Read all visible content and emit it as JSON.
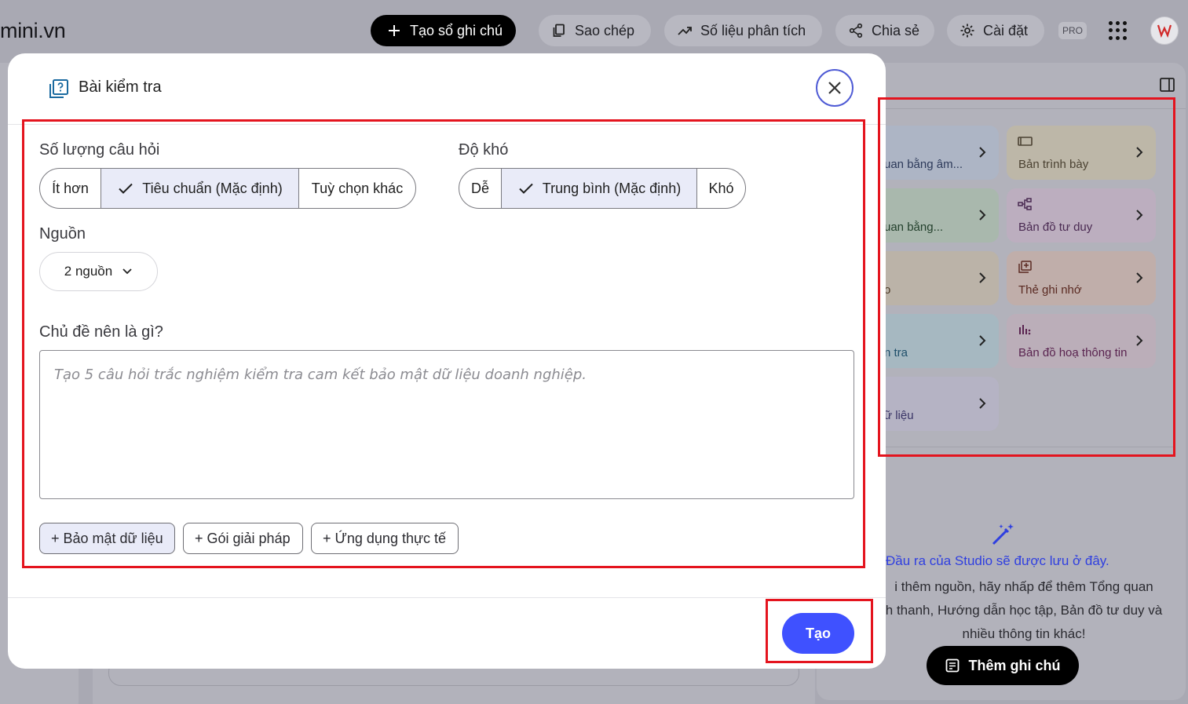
{
  "topbar": {
    "logo": "mini.vn",
    "create_notebook": "Tạo sổ ghi chú",
    "copy": "Sao chép",
    "analytics": "Số liệu phân tích",
    "share": "Chia sẻ",
    "settings": "Cài đặt",
    "pro_badge": "PRO"
  },
  "studio": {
    "tiles": [
      {
        "label": "uan bằng âm...",
        "color": "#adb5c5",
        "text_color": "#2d3a5a",
        "icon": "audio-icon"
      },
      {
        "label": "Bản trình bày",
        "color": "#bdb7a8",
        "text_color": "#4b4232",
        "icon": "slides-icon"
      },
      {
        "label": "uan bằng...",
        "color": "#a9b8ad",
        "text_color": "#23402c",
        "icon": "video-icon"
      },
      {
        "label": "Bản đồ tư duy",
        "color": "#bcaebf",
        "text_color": "#4a2a52",
        "icon": "mindmap-icon"
      },
      {
        "label": "o",
        "color": "#bbb3a8",
        "text_color": "#4d3b28",
        "icon": "report-icon"
      },
      {
        "label": "Thẻ ghi nhớ",
        "color": "#c0aeaa",
        "text_color": "#5a2a22",
        "icon": "flashcard-icon"
      },
      {
        "label": "n tra",
        "color": "#a6b8c1",
        "text_color": "#1f4f6a",
        "icon": "quiz-icon"
      },
      {
        "label": "Bản đồ hoạ thông tin",
        "color": "#bbaeb9",
        "text_color": "#5a2450",
        "icon": "infographic-icon"
      },
      {
        "label": "ữ liệu",
        "color": "#b5b3c4",
        "text_color": "#3a3566",
        "icon": "table-icon"
      }
    ],
    "empty_title": "Đầu ra của Studio sẽ được lưu ở đây.",
    "empty_desc": "i thêm nguồn, hãy nhấp để thêm Tổng quan\nh thanh, Hướng dẫn học tập, Bản đồ tư duy và\nnhiều thông tin khác!",
    "add_note": "Thêm ghi chú"
  },
  "modal": {
    "title": "Bài kiểm tra",
    "question_count": {
      "label": "Số lượng câu hỏi",
      "options": [
        "Ít hơn",
        "Tiêu chuẩn (Mặc định)",
        "Tuỳ chọn khác"
      ],
      "selected": "Tiêu chuẩn (Mặc định)"
    },
    "difficulty": {
      "label": "Độ khó",
      "options": [
        "Dễ",
        "Trung bình (Mặc định)",
        "Khó"
      ],
      "selected": "Trung bình (Mặc định)"
    },
    "source": {
      "label": "Nguồn",
      "value": "2 nguồn"
    },
    "topic": {
      "label": "Chủ đề nên là gì?",
      "placeholder": "Tạo 5 câu hỏi trắc nghiệm kiểm tra cam kết bảo mật dữ liệu doanh nghiệp."
    },
    "suggestions": [
      "+ Bảo mật dữ liệu",
      "+ Gói giải pháp",
      "+ Ứng dụng thực tế"
    ],
    "create_button": "Tạo"
  },
  "colors": {
    "accent": "#3f51ff",
    "annotation": "#e4141e",
    "selected_segment": "#e9ebf8"
  }
}
